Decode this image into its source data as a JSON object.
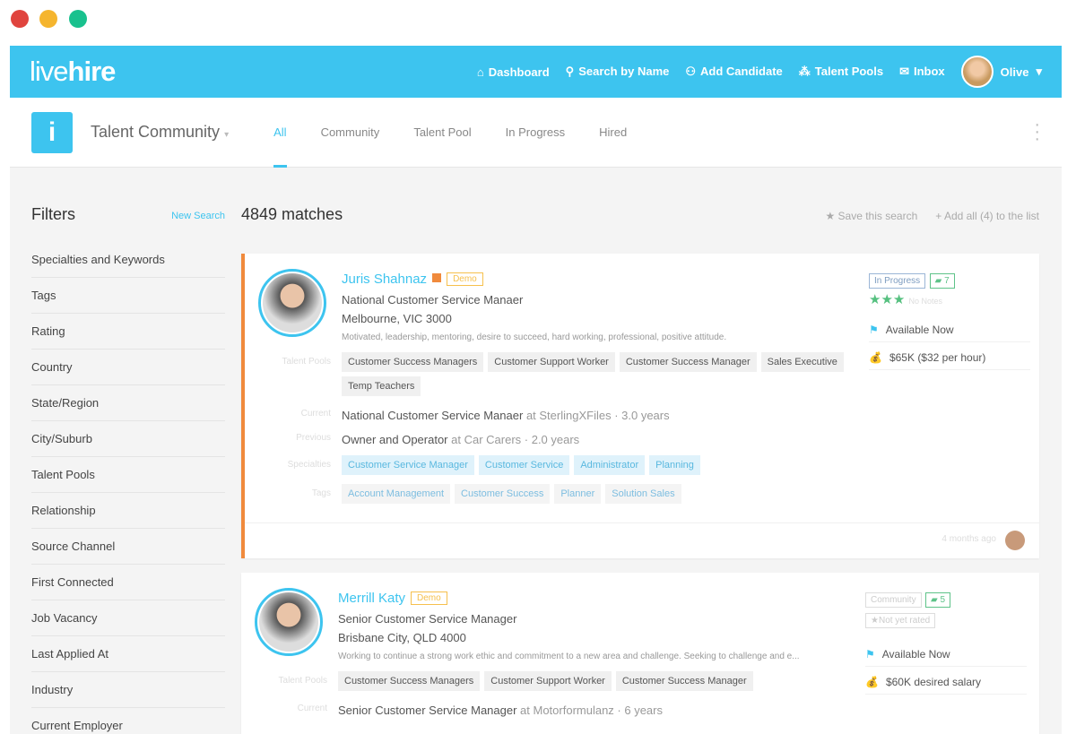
{
  "window": {
    "colors": [
      "#e0443e",
      "#f5b52e",
      "#19c18e"
    ]
  },
  "header": {
    "logo": "livehire",
    "nav": [
      {
        "icon": "home-icon",
        "glyph": "⌂",
        "label": "Dashboard"
      },
      {
        "icon": "search-person-icon",
        "glyph": "⚲",
        "label": "Search by Name"
      },
      {
        "icon": "add-user-icon",
        "glyph": "⚇",
        "label": "Add Candidate"
      },
      {
        "icon": "pools-icon",
        "glyph": "⁂",
        "label": "Talent Pools"
      },
      {
        "icon": "inbox-icon",
        "glyph": "✉",
        "label": "Inbox"
      }
    ],
    "user": "Olive"
  },
  "subheader": {
    "title": "Talent Community",
    "tabs": [
      "All",
      "Community",
      "Talent Pool",
      "In Progress",
      "Hired"
    ]
  },
  "filters": {
    "title": "Filters",
    "new_search": "New Search",
    "items": [
      "Specialties and Keywords",
      "Tags",
      "Rating",
      "Country",
      "State/Region",
      "City/Suburb",
      "Talent Pools",
      "Relationship",
      "Source Channel",
      "First Connected",
      "Job Vacancy",
      "Last Applied At",
      "Industry",
      "Current Employer"
    ]
  },
  "results": {
    "count": "4849 matches",
    "save": "Save this search",
    "add_all": "Add all (4) to the list"
  },
  "labels": {
    "talent_pools": "Talent Pools",
    "current": "Current",
    "previous": "Previous",
    "specialties": "Specialties",
    "tags": "Tags"
  },
  "candidates": [
    {
      "name": "Juris Shahnaz",
      "demo": "Demo",
      "title": "National Customer Service Manaer",
      "location": "Melbourne, VIC 3000",
      "summary": "Motivated, leadership, mentoring, desire to succeed, hard working, professional, positive attitude.",
      "pools": [
        "Customer Success Managers",
        "Customer Support Worker",
        "Customer Success Manager",
        "Sales Executive",
        "Temp Teachers"
      ],
      "current_role": "National Customer Service Manaer",
      "current_at": "at SterlingXFiles · 3.0 years",
      "previous_role": "Owner and Operator",
      "previous_at": "at Car Carers · 2.0 years",
      "specialties": [
        "Customer Service Manager",
        "Customer Service",
        "Administrator",
        "Planning"
      ],
      "tags": [
        "Account Management",
        "Customer Success",
        "Planner",
        "Solution Sales"
      ],
      "status": "In Progress",
      "jobs": "7",
      "rating": 3,
      "rating_note": "No Notes",
      "availability": "Available Now",
      "salary": "$65K ($32 per hour)",
      "updated": "4 months ago"
    },
    {
      "name": "Merrill Katy",
      "demo": "Demo",
      "title": "Senior Customer Service Manager",
      "location": "Brisbane City, QLD 4000",
      "summary": "Working to continue a strong work ethic and commitment to a new area and challenge. Seeking to challenge and e...",
      "pools": [
        "Customer Success Managers",
        "Customer Support Worker",
        "Customer Success Manager"
      ],
      "current_role": "Senior Customer Service Manager",
      "current_at": "at Motorformulanz · 6 years",
      "status": "Community",
      "jobs": "5",
      "rating_note": "Not yet rated",
      "availability": "Available Now",
      "salary": "$60K desired salary"
    }
  ]
}
